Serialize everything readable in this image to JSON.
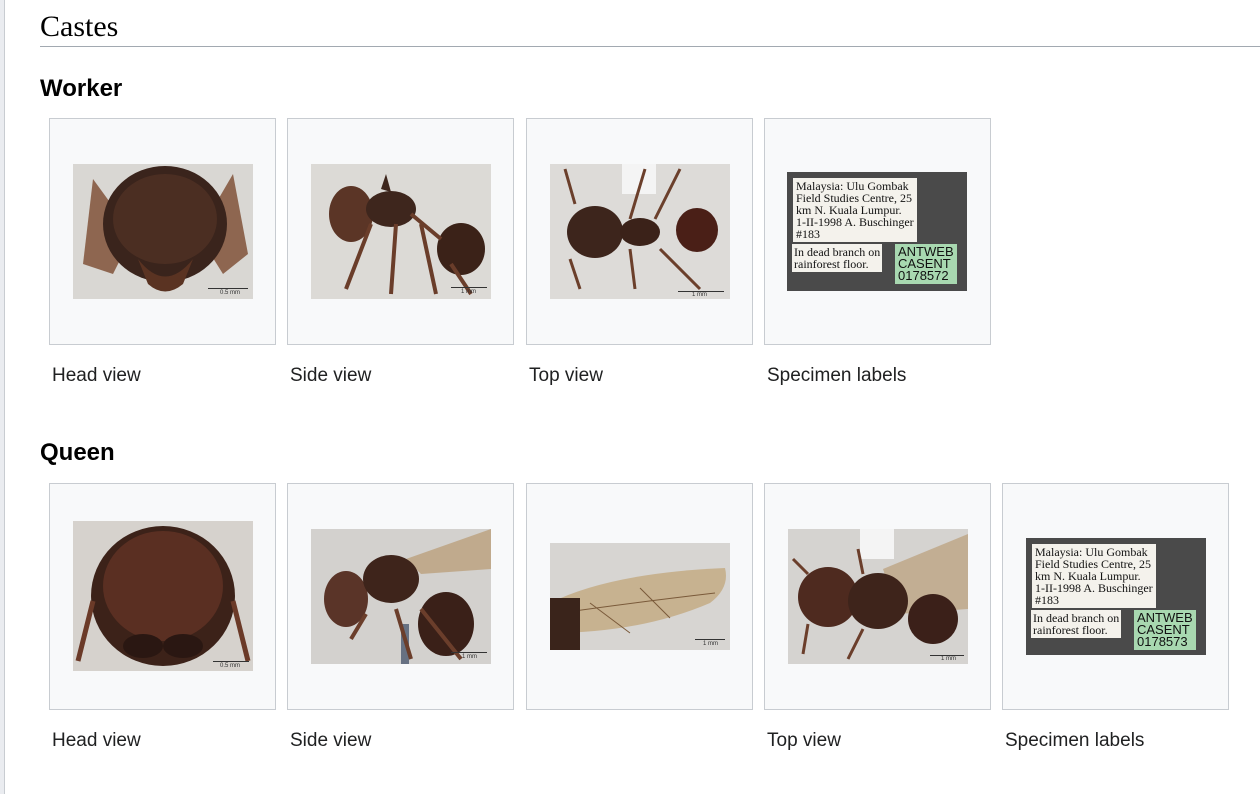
{
  "section": {
    "title": "Castes"
  },
  "worker": {
    "heading": "Worker",
    "tiles": [
      {
        "caption": "Head view",
        "scale": "0.5 mm",
        "image": "ant-worker-head-photo"
      },
      {
        "caption": "Side view",
        "scale": "1 mm",
        "image": "ant-worker-side-photo"
      },
      {
        "caption": "Top view",
        "scale": "1 mm",
        "image": "ant-worker-top-photo"
      },
      {
        "caption": "Specimen labels",
        "image": "specimen-labels-photo",
        "label_main": "Malaysia: Ulu Gombak\nField Studies Centre, 25\nkm N. Kuala Lumpur.\n1-II-1998 A. Buschinger\n#183",
        "label_note": "In dead branch on\nrainforest floor.",
        "label_code": "ANTWEB\nCASENT\n0178572"
      }
    ]
  },
  "queen": {
    "heading": "Queen",
    "tiles": [
      {
        "caption": "Head view",
        "scale": "0.5 mm",
        "image": "ant-queen-head-photo"
      },
      {
        "caption": "Side view",
        "scale": "1 mm",
        "image": "ant-queen-side-photo"
      },
      {
        "caption": "",
        "scale": "1 mm",
        "image": "ant-queen-wing-photo"
      },
      {
        "caption": "Top view",
        "scale": "1 mm",
        "image": "ant-queen-top-photo"
      },
      {
        "caption": "Specimen labels",
        "image": "specimen-labels-photo",
        "label_main": "Malaysia: Ulu Gombak\nField Studies Centre, 25\nkm N. Kuala Lumpur.\n1-II-1998 A. Buschinger\n#183",
        "label_note": "In dead branch on\nrainforest floor.",
        "label_code": "ANTWEB\nCASENT\n0178573"
      }
    ]
  }
}
